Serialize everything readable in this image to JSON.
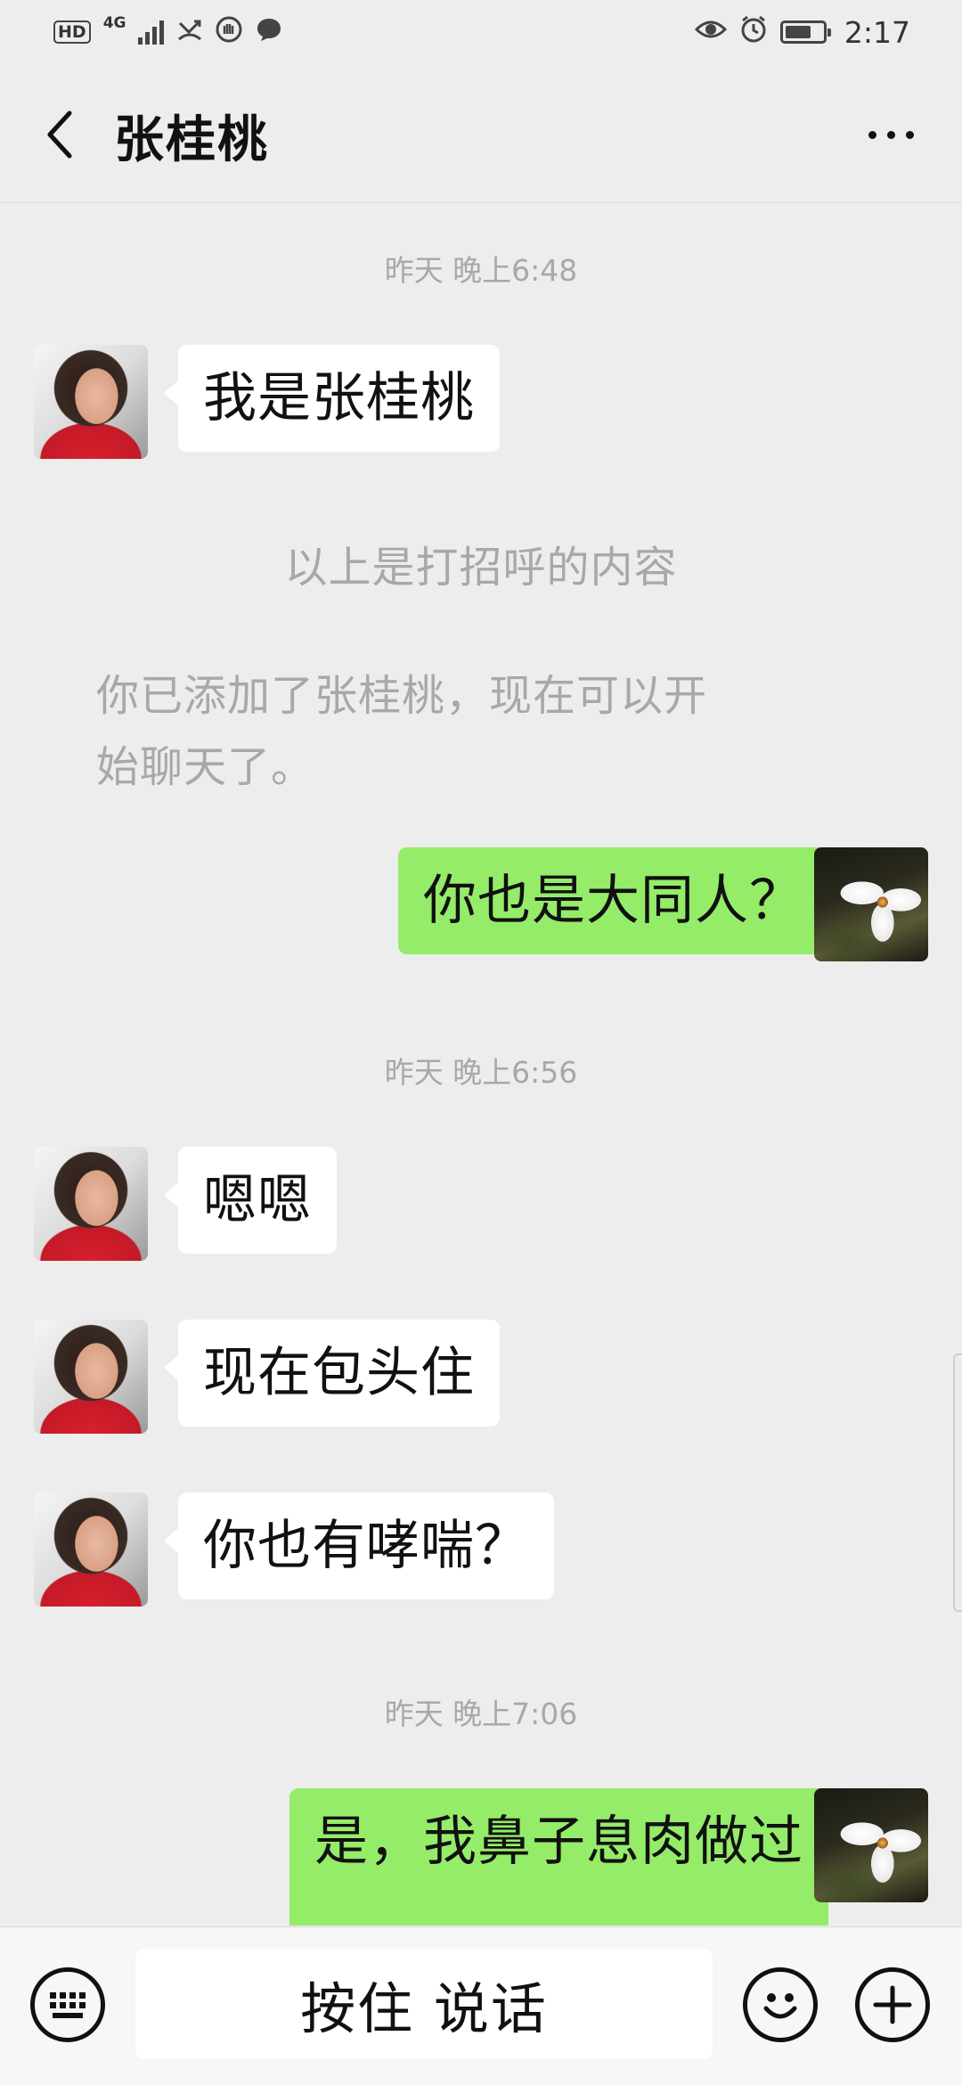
{
  "status_bar": {
    "hd": "HD",
    "network": "4G",
    "time": "2:17",
    "battery_level": 0.7,
    "icons": [
      "signal-icon",
      "missed-call-icon",
      "hand-icon",
      "message-icon",
      "eye-icon",
      "alarm-icon",
      "battery-icon"
    ]
  },
  "header": {
    "title": "张桂桃"
  },
  "chat": {
    "timestamps": [
      "昨天 晚上6:48",
      "昨天 晚上6:56",
      "昨天 晚上7:06"
    ],
    "messages": [
      {
        "side": "left",
        "text": "我是张桂桃"
      },
      {
        "side": "right",
        "text": "你也是大同人？"
      },
      {
        "side": "left",
        "text": "嗯嗯"
      },
      {
        "side": "left",
        "text": "现在包头住"
      },
      {
        "side": "left",
        "text": "你也有哮喘？"
      },
      {
        "side": "right",
        "text": "是，我鼻子息肉做过"
      }
    ],
    "system": [
      "以上是打招呼的内容",
      "你已添加了张桂桃，现在可以开",
      "始聊天了。"
    ]
  },
  "input_bar": {
    "hold_to_talk": "按住 说话"
  },
  "colors": {
    "background": "#ededed",
    "sent_bubble": "#95ec69",
    "received_bubble": "#ffffff",
    "system_text": "#a8a8a8"
  }
}
